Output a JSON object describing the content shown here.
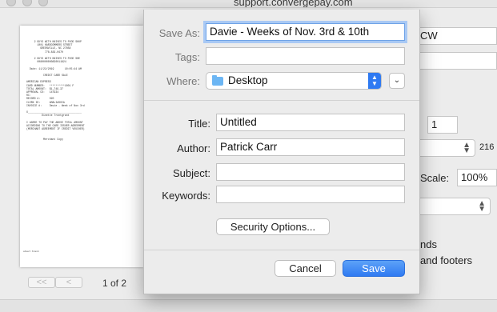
{
  "window": {
    "title": "support.convergepay.com"
  },
  "preview": {
    "receipt_lines": [
      "     2 GUYS WITH KNIVES TO FOOD SHOP",
      "       1001 HARDCOMMERS STREET",
      "         GREENVILLE, NC 27858",
      "            778-829-0470",
      "",
      "     2 GUYS WITH KNIVES TO FOOD SHE",
      "       0080000000830011824",
      "",
      "  Date: 11/22/2019       10:05:44 AM",
      "",
      "           CREDIT CARD SALE",
      "",
      "AMERICAN EXPRESS",
      "CARD NUMBER:   **********1001 F",
      "TOTAL AMOUNT:  $1,749.37",
      "APPROVAL CD:   147934",
      "RC:",
      "RECORD #:      020",
      "CLERK ID:      AMALIASOIA",
      "INVOICE #:     Davie - Week of Nov 3rd",
      "",
      "X___________________________________",
      "          Dinette Trontgrant",
      "",
      "I AGREE TO PAY THE ABOVE TOTAL AMOUNT",
      "ACCORDING TO THE CARD ISSUER AGREEMENT",
      "(MERCHANT AGREEMENT IF CREDIT VOUCHER)",
      "",
      "",
      "           Merchant Copy"
    ],
    "footer": "about:blank",
    "page_count": "1 of 2",
    "first_page_label": "<<",
    "prev_page_label": "<"
  },
  "background_panel": {
    "printer_fragment": "CW",
    "copies_value": "1",
    "paper_size_suffix": "216",
    "scale_label": "Scale:",
    "scale_value": "100%",
    "option_fragment_1": "nds",
    "option_fragment_2": "and footers"
  },
  "save_dialog": {
    "save_as_label": "Save As:",
    "save_as_value": "Davie - Weeks of Nov. 3rd & 10th",
    "tags_label": "Tags:",
    "tags_value": "",
    "where_label": "Where:",
    "where_value": "Desktop",
    "where_icon": "folder-icon",
    "title_label": "Title:",
    "title_value": "Untitled",
    "author_label": "Author:",
    "author_value": "Patrick Carr",
    "subject_label": "Subject:",
    "subject_value": "",
    "keywords_label": "Keywords:",
    "keywords_value": "",
    "security_button": "Security Options...",
    "cancel_button": "Cancel",
    "save_button": "Save",
    "accent_color": "#2f7af2",
    "focus_ring_color": "#a9c9f4"
  }
}
